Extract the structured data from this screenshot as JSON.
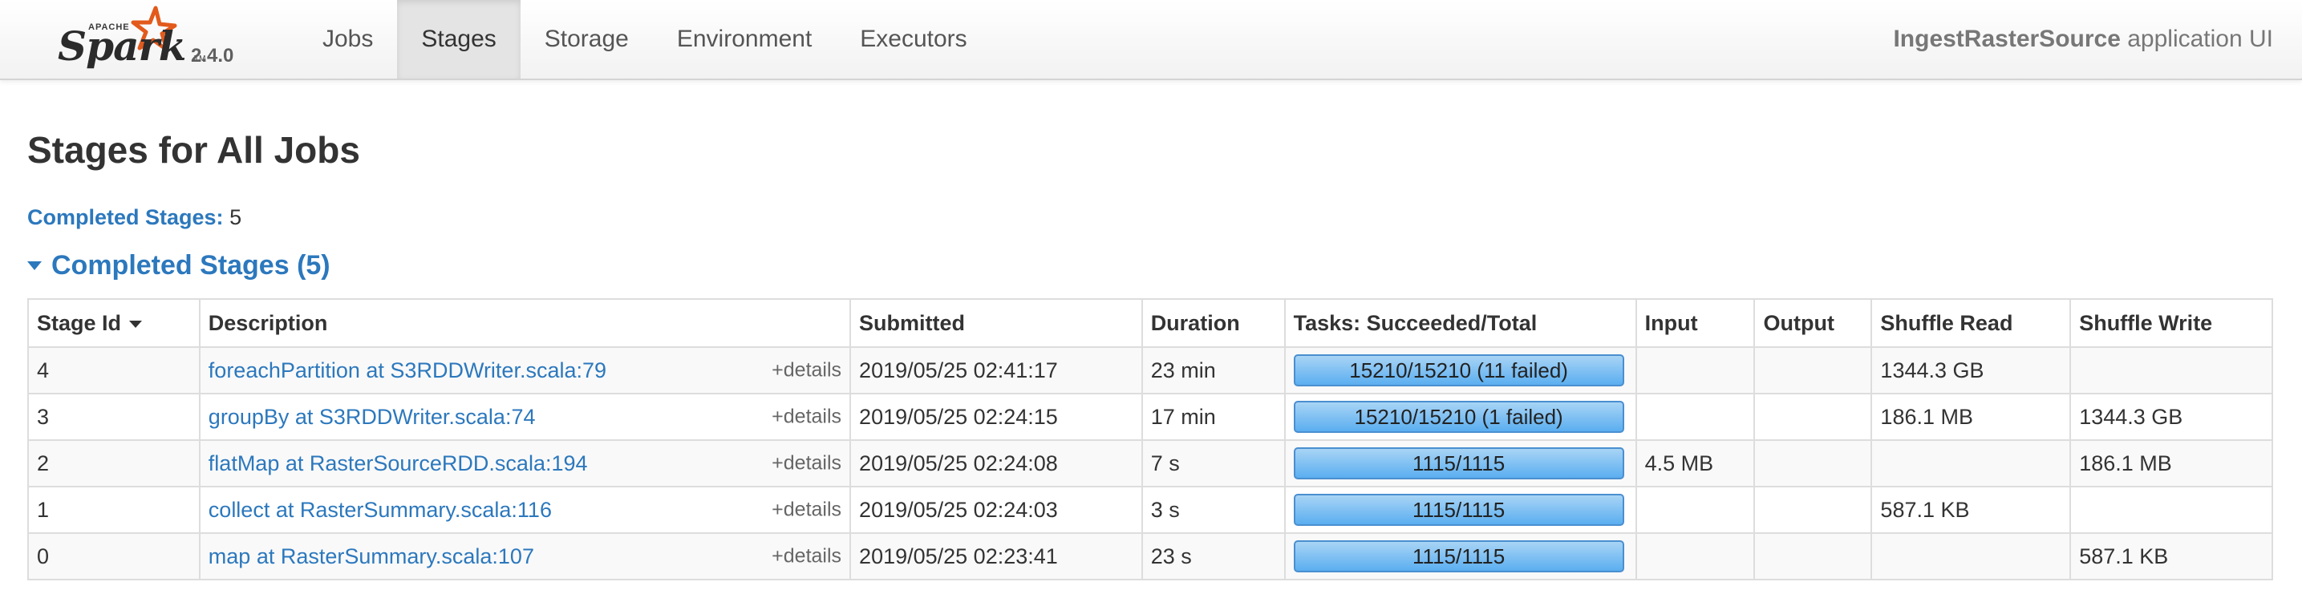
{
  "navbar": {
    "brand_apache": "APACHE",
    "brand_name": "Spark",
    "brand_tm": "TM",
    "version": "2.4.0",
    "tabs": [
      {
        "label": "Jobs",
        "active": false
      },
      {
        "label": "Stages",
        "active": true
      },
      {
        "label": "Storage",
        "active": false
      },
      {
        "label": "Environment",
        "active": false
      },
      {
        "label": "Executors",
        "active": false
      }
    ],
    "app_name": "IngestRasterSource",
    "app_suffix": " application UI"
  },
  "page": {
    "title": "Stages for All Jobs",
    "summary_label": "Completed Stages:",
    "summary_count": "5",
    "section_title": "Completed Stages (5)"
  },
  "table": {
    "headers": [
      "Stage Id",
      "Description",
      "Submitted",
      "Duration",
      "Tasks: Succeeded/Total",
      "Input",
      "Output",
      "Shuffle Read",
      "Shuffle Write"
    ],
    "details_label": "+details",
    "rows": [
      {
        "id": "4",
        "description": "foreachPartition at S3RDDWriter.scala:79",
        "submitted": "2019/05/25 02:41:17",
        "duration": "23 min",
        "tasks": "15210/15210 (11 failed)",
        "tasks_fraction": 1.0,
        "input": "",
        "output": "",
        "shuffle_read": "1344.3 GB",
        "shuffle_write": ""
      },
      {
        "id": "3",
        "description": "groupBy at S3RDDWriter.scala:74",
        "submitted": "2019/05/25 02:24:15",
        "duration": "17 min",
        "tasks": "15210/15210 (1 failed)",
        "tasks_fraction": 1.0,
        "input": "",
        "output": "",
        "shuffle_read": "186.1 MB",
        "shuffle_write": "1344.3 GB"
      },
      {
        "id": "2",
        "description": "flatMap at RasterSourceRDD.scala:194",
        "submitted": "2019/05/25 02:24:08",
        "duration": "7 s",
        "tasks": "1115/1115",
        "tasks_fraction": 1.0,
        "input": "4.5 MB",
        "output": "",
        "shuffle_read": "",
        "shuffle_write": "186.1 MB"
      },
      {
        "id": "1",
        "description": "collect at RasterSummary.scala:116",
        "submitted": "2019/05/25 02:24:03",
        "duration": "3 s",
        "tasks": "1115/1115",
        "tasks_fraction": 1.0,
        "input": "",
        "output": "",
        "shuffle_read": "587.1 KB",
        "shuffle_write": ""
      },
      {
        "id": "0",
        "description": "map at RasterSummary.scala:107",
        "submitted": "2019/05/25 02:23:41",
        "duration": "23 s",
        "tasks": "1115/1115",
        "tasks_fraction": 1.0,
        "input": "",
        "output": "",
        "shuffle_read": "",
        "shuffle_write": "587.1 KB"
      }
    ]
  },
  "colors": {
    "link": "#2c78bd",
    "progress": "#5aaef0",
    "star": "#e25a1c"
  }
}
